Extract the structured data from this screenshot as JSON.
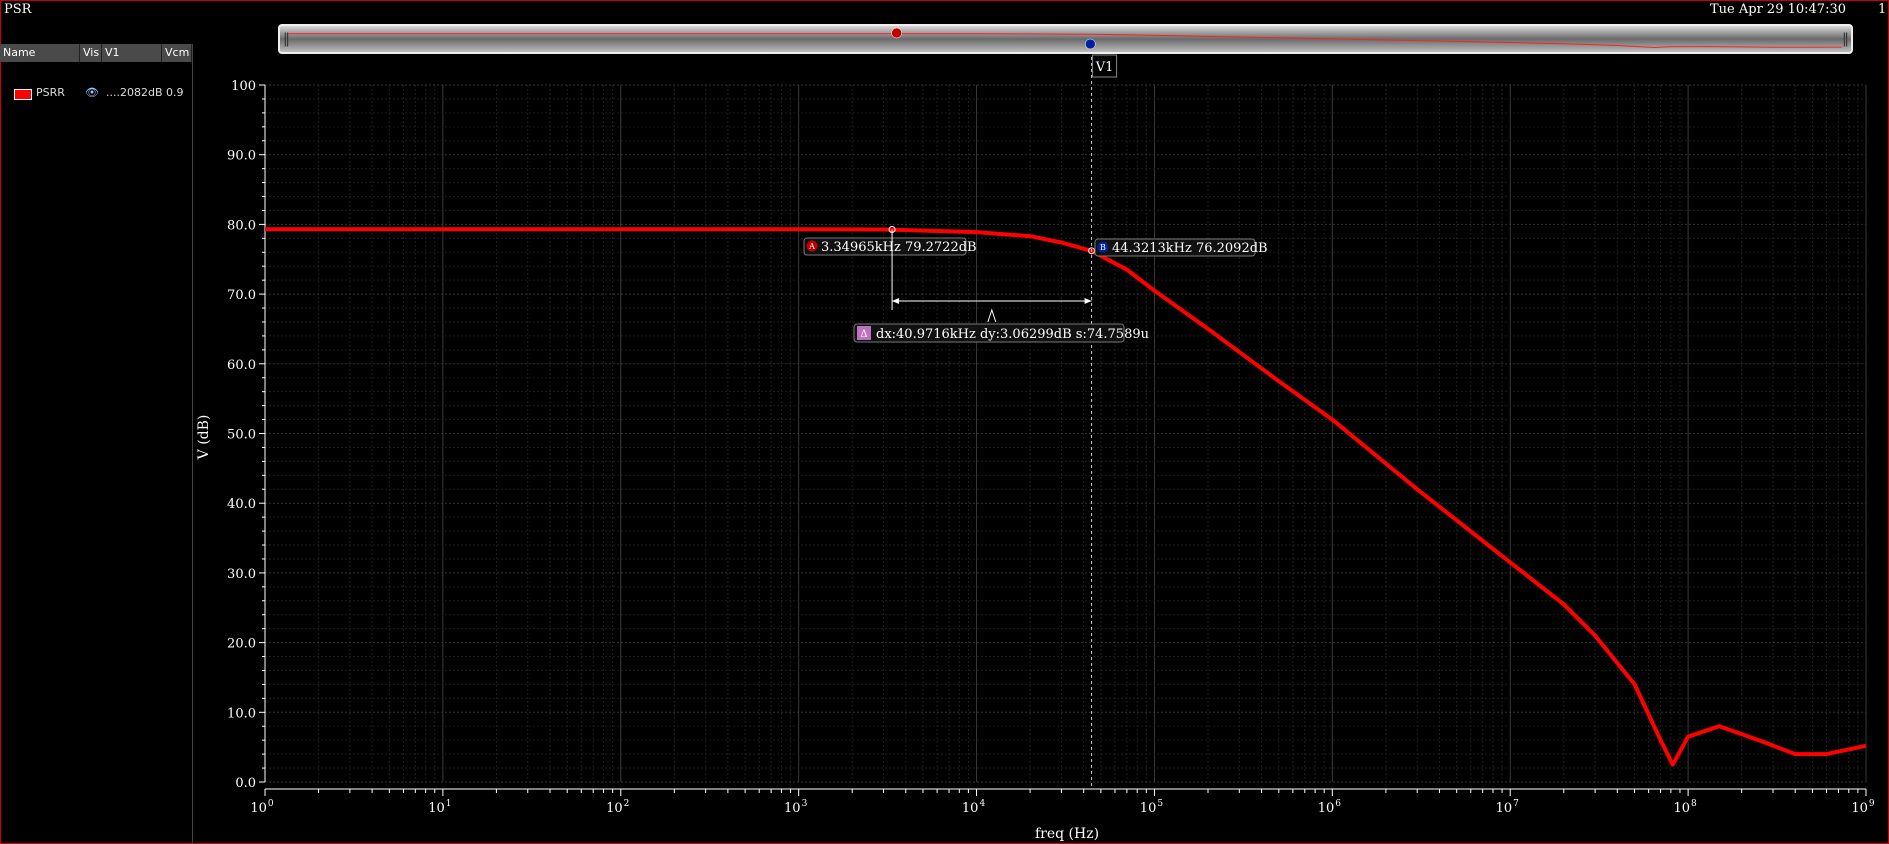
{
  "window": {
    "title": "PSR",
    "datetime": "Tue Apr 29 10:47:30",
    "page": "1"
  },
  "legend": {
    "headers": [
      "Name",
      "Vis",
      "V1",
      "Vcm"
    ],
    "rows": [
      {
        "name": "PSRR",
        "v1": "....2082dB",
        "vcm": "0.9",
        "color": "#ff0000",
        "visible_icon": "eye-icon"
      }
    ]
  },
  "cursor": {
    "label": "V1",
    "x": 44321.3
  },
  "markers": {
    "A": {
      "label": "A",
      "text": "3.34965kHz 79.2722dB",
      "x": 3349.65,
      "y": 79.2722
    },
    "B": {
      "label": "B",
      "text": "44.3213kHz 76.2092dB",
      "x": 44321.3,
      "y": 76.2092
    },
    "delta": {
      "label": "Δ",
      "text": "dx:40.9716kHz dy:3.06299dB s:74.7589u"
    }
  },
  "chart_data": {
    "type": "line",
    "xlabel": "freq (Hz)",
    "ylabel": "V (dB)",
    "xscale": "log",
    "xlim": [
      1,
      1000000000
    ],
    "ylim": [
      0,
      100
    ],
    "grid": true,
    "yticks": [
      "100",
      "90.0",
      "80.0",
      "70.0",
      "60.0",
      "50.0",
      "40.0",
      "30.0",
      "20.0",
      "10.0",
      "0.0"
    ],
    "xticks": [
      {
        "base": "10",
        "exp": "0"
      },
      {
        "base": "10",
        "exp": "1"
      },
      {
        "base": "10",
        "exp": "2"
      },
      {
        "base": "10",
        "exp": "3"
      },
      {
        "base": "10",
        "exp": "4"
      },
      {
        "base": "10",
        "exp": "5"
      },
      {
        "base": "10",
        "exp": "6"
      },
      {
        "base": "10",
        "exp": "7"
      },
      {
        "base": "10",
        "exp": "8"
      },
      {
        "base": "10",
        "exp": "9"
      }
    ],
    "series": [
      {
        "name": "PSRR",
        "color": "#ff0000",
        "x": [
          1,
          10,
          100,
          1000,
          3000,
          10000,
          20000,
          30000,
          44321,
          70000,
          100000,
          200000,
          500000,
          1000000,
          3000000,
          10000000,
          20000000,
          30000000,
          50000000,
          70000000,
          82000000,
          100000000,
          150000000,
          250000000,
          400000000,
          600000000,
          1000000000
        ],
        "y": [
          79.3,
          79.3,
          79.3,
          79.3,
          79.27,
          78.9,
          78.3,
          77.4,
          76.2,
          73.5,
          70.5,
          65.0,
          57.5,
          52.0,
          42.0,
          31.5,
          25.5,
          21.0,
          14.0,
          6.0,
          2.5,
          6.5,
          8.0,
          6.0,
          4.0,
          4.0,
          5.2
        ]
      }
    ]
  }
}
